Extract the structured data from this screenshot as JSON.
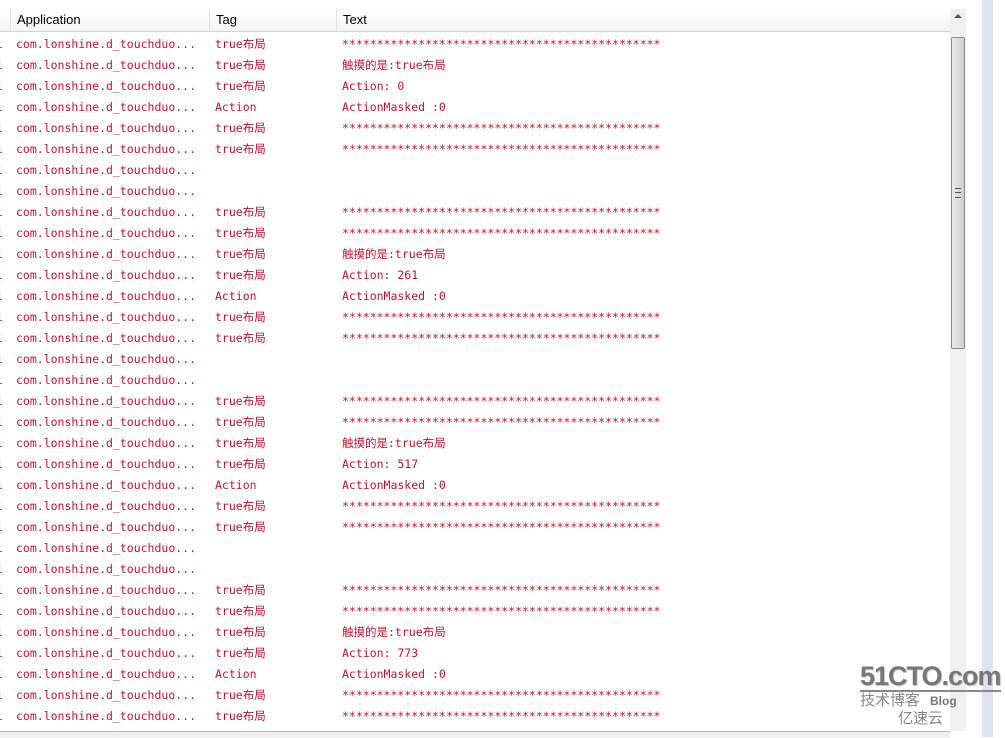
{
  "columns": [
    "Application",
    "Tag",
    "Text"
  ],
  "colors": {
    "log_text": "#c8102e",
    "accent_strip": "#dde3f3"
  },
  "rows": [
    {
      "app": "com.lonshine.d_touchduo...",
      "tag": "true布局",
      "text": "**********************************************"
    },
    {
      "app": "com.lonshine.d_touchduo...",
      "tag": "true布局",
      "text": "触摸的是:true布局"
    },
    {
      "app": "com.lonshine.d_touchduo...",
      "tag": "true布局",
      "text": "Action: 0"
    },
    {
      "app": "com.lonshine.d_touchduo...",
      "tag": "Action",
      "text": "ActionMasked :0"
    },
    {
      "app": "com.lonshine.d_touchduo...",
      "tag": "true布局",
      "text": "**********************************************"
    },
    {
      "app": "com.lonshine.d_touchduo...",
      "tag": "true布局",
      "text": "**********************************************"
    },
    {
      "app": "com.lonshine.d_touchduo...",
      "tag": "",
      "text": ""
    },
    {
      "app": "com.lonshine.d_touchduo...",
      "tag": "",
      "text": ""
    },
    {
      "app": "com.lonshine.d_touchduo...",
      "tag": "true布局",
      "text": "**********************************************"
    },
    {
      "app": "com.lonshine.d_touchduo...",
      "tag": "true布局",
      "text": "**********************************************"
    },
    {
      "app": "com.lonshine.d_touchduo...",
      "tag": "true布局",
      "text": "触摸的是:true布局"
    },
    {
      "app": "com.lonshine.d_touchduo...",
      "tag": "true布局",
      "text": "Action: 261"
    },
    {
      "app": "com.lonshine.d_touchduo...",
      "tag": "Action",
      "text": "ActionMasked :0"
    },
    {
      "app": "com.lonshine.d_touchduo...",
      "tag": "true布局",
      "text": "**********************************************"
    },
    {
      "app": "com.lonshine.d_touchduo...",
      "tag": "true布局",
      "text": "**********************************************"
    },
    {
      "app": "com.lonshine.d_touchduo...",
      "tag": "",
      "text": ""
    },
    {
      "app": "com.lonshine.d_touchduo...",
      "tag": "",
      "text": ""
    },
    {
      "app": "com.lonshine.d_touchduo...",
      "tag": "true布局",
      "text": "**********************************************"
    },
    {
      "app": "com.lonshine.d_touchduo...",
      "tag": "true布局",
      "text": "**********************************************"
    },
    {
      "app": "com.lonshine.d_touchduo...",
      "tag": "true布局",
      "text": "触摸的是:true布局"
    },
    {
      "app": "com.lonshine.d_touchduo...",
      "tag": "true布局",
      "text": "Action: 517"
    },
    {
      "app": "com.lonshine.d_touchduo...",
      "tag": "Action",
      "text": "ActionMasked :0"
    },
    {
      "app": "com.lonshine.d_touchduo...",
      "tag": "true布局",
      "text": "**********************************************"
    },
    {
      "app": "com.lonshine.d_touchduo...",
      "tag": "true布局",
      "text": "**********************************************"
    },
    {
      "app": "com.lonshine.d_touchduo...",
      "tag": "",
      "text": ""
    },
    {
      "app": "com.lonshine.d_touchduo...",
      "tag": "",
      "text": ""
    },
    {
      "app": "com.lonshine.d_touchduo...",
      "tag": "true布局",
      "text": "**********************************************"
    },
    {
      "app": "com.lonshine.d_touchduo...",
      "tag": "true布局",
      "text": "**********************************************"
    },
    {
      "app": "com.lonshine.d_touchduo...",
      "tag": "true布局",
      "text": "触摸的是:true布局"
    },
    {
      "app": "com.lonshine.d_touchduo...",
      "tag": "true布局",
      "text": "Action: 773"
    },
    {
      "app": "com.lonshine.d_touchduo...",
      "tag": "Action",
      "text": "ActionMasked :0"
    },
    {
      "app": "com.lonshine.d_touchduo...",
      "tag": "true布局",
      "text": "**********************************************"
    },
    {
      "app": "com.lonshine.d_touchduo...",
      "tag": "true布局",
      "text": "**********************************************"
    }
  ],
  "watermark": {
    "brand": "51CTO.com",
    "sub": "技术博客",
    "blog": "Blog",
    "partner": "亿速云"
  }
}
